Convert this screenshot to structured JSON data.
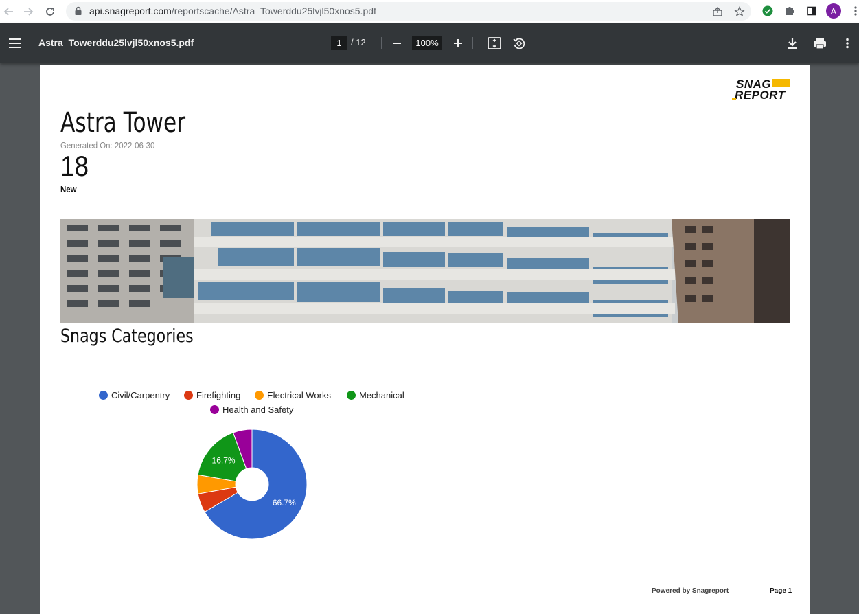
{
  "browser": {
    "url_host": "api.snagreport.com",
    "url_path": "/reportscache/Astra_Towerddu25lvjl50xnos5.pdf",
    "avatar_letter": "A"
  },
  "pdf_toolbar": {
    "file_name": "Astra_Towerddu25lvjl50xnos5.pdf",
    "current_page": "1",
    "total_pages": "/ 12",
    "zoom": "100%"
  },
  "report": {
    "logo_line1": "SNAG",
    "logo_line2": "REPORT",
    "title": "Astra Tower",
    "generated_on": "Generated On: 2022-06-30",
    "count": "18",
    "count_label": "New",
    "section_title": "Snags Categories",
    "footer_powered": "Powered by Snagreport",
    "footer_page": "Page 1"
  },
  "chart_data": {
    "type": "pie",
    "donut": true,
    "legend_placement": "top",
    "categories": [
      "Civil/Carpentry",
      "Firefighting",
      "Electrical Works",
      "Mechanical",
      "Health and Safety"
    ],
    "values": [
      66.7,
      5.6,
      5.6,
      16.7,
      5.6
    ],
    "colors": [
      "#3366cc",
      "#dc3912",
      "#ff9900",
      "#109618",
      "#990099"
    ],
    "data_labels": [
      "66.7%",
      "",
      "",
      "16.7%",
      ""
    ]
  }
}
